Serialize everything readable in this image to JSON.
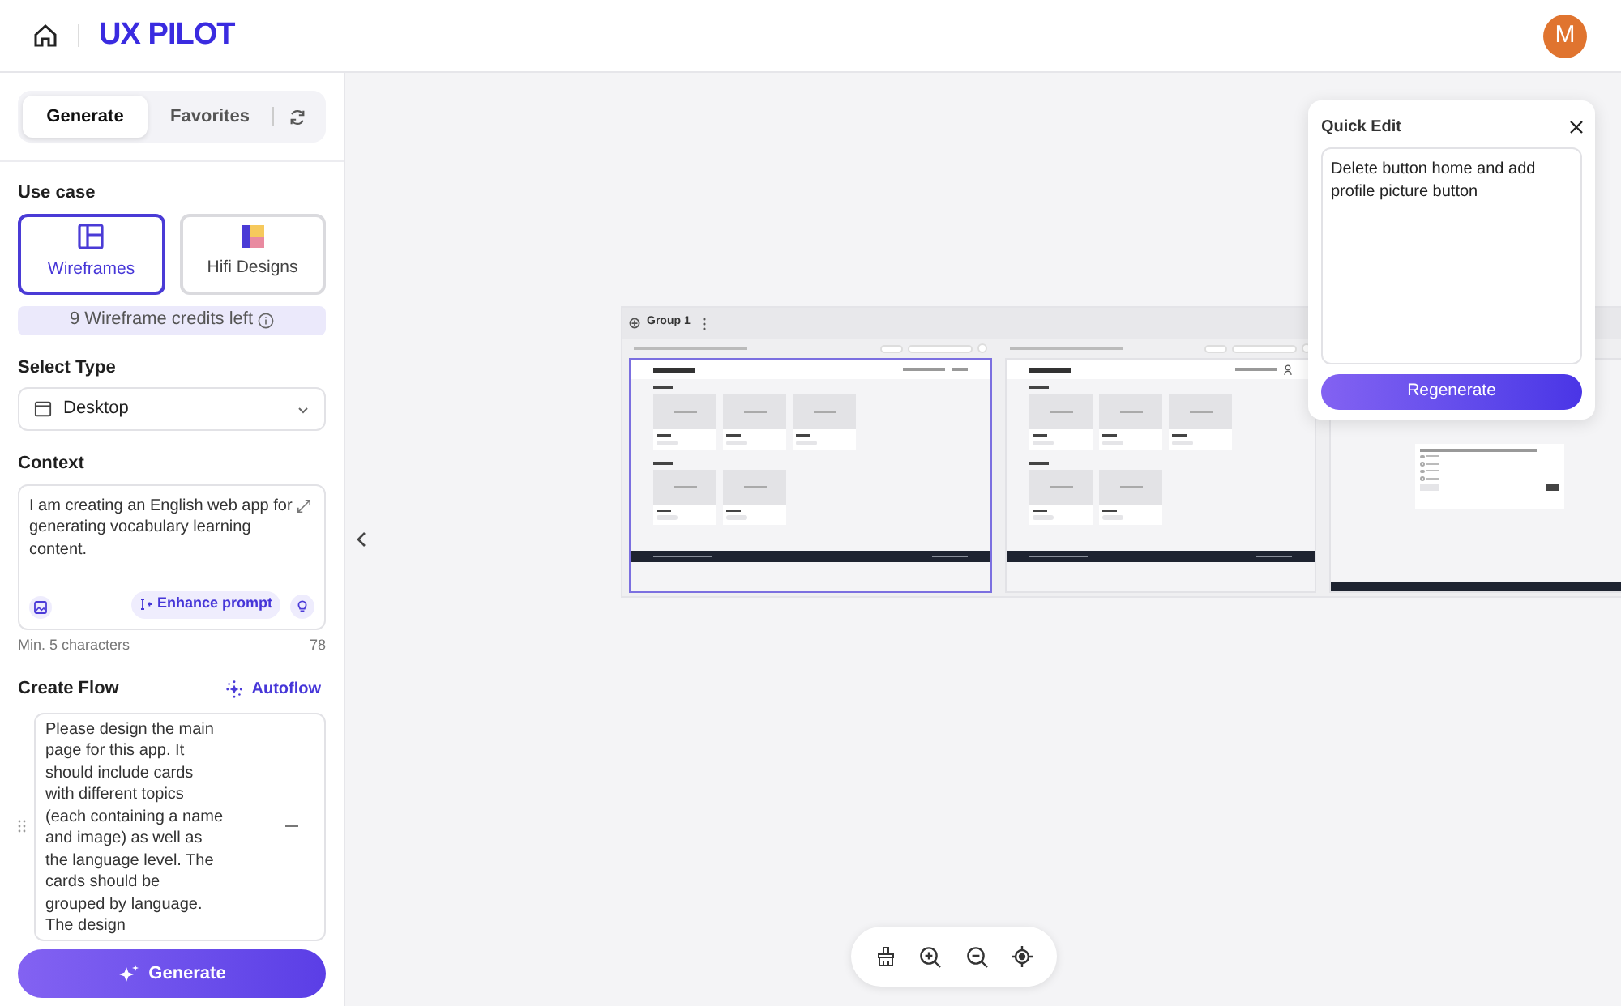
{
  "header": {
    "brand": "UX PILOT",
    "avatar": "M"
  },
  "sidebar": {
    "tabs": [
      {
        "label": "Generate",
        "selected": true
      },
      {
        "label": "Favorites",
        "selected": false
      }
    ],
    "use_case": {
      "label": "Use case",
      "options": [
        {
          "label": "Wireframes",
          "kind": "wireframes",
          "selected": true
        },
        {
          "label": "Hifi Designs",
          "kind": "hifi",
          "selected": false
        }
      ],
      "credits": "9 Wireframe credits left"
    },
    "select_type": {
      "label": "Select Type",
      "value": "Desktop"
    },
    "context": {
      "label": "Context",
      "value": "I am creating an English web app for generating vocabulary learning content.",
      "enhance": "Enhance prompt",
      "hint": "Min. 5 characters",
      "count": "78"
    },
    "create_flow": {
      "label": "Create Flow",
      "autoflow": "Autoflow",
      "steps": [
        "Please design the main page for this app. It should include cards with different topics (each containing a name and image) as well as the language level. The cards should be grouped by language. The design"
      ]
    },
    "generate": "Generate"
  },
  "canvas": {
    "group": "Group 1",
    "frames": [
      {
        "kind": "topics",
        "selected": true
      },
      {
        "kind": "topics",
        "selected": false,
        "profile_icon": true
      },
      {
        "kind": "quiz",
        "selected": false
      }
    ],
    "quick_edit": {
      "title": "Quick Edit",
      "value": "Delete button home and add profile picture button",
      "button": "Regenerate"
    }
  }
}
